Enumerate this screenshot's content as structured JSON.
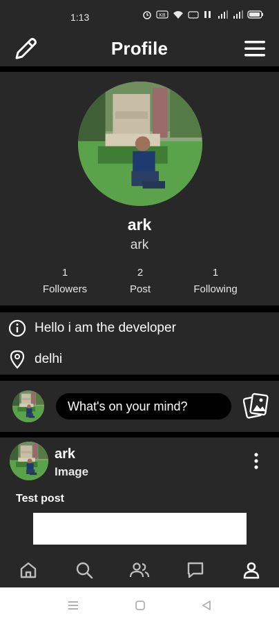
{
  "status_bar": {
    "time": "1:13",
    "icons": [
      "alarm-icon",
      "speed-icon",
      "wifi-icon",
      "volte-icon",
      "data-icon",
      "signal-icon",
      "signal-icon",
      "battery-icon"
    ]
  },
  "header": {
    "title": "Profile",
    "left_icon": "edit-icon",
    "right_icon": "menu-icon"
  },
  "profile": {
    "name": "ark",
    "username": "ark",
    "stats": [
      {
        "value": "1",
        "label": "Followers"
      },
      {
        "value": "2",
        "label": "Post"
      },
      {
        "value": "1",
        "label": "Following"
      }
    ]
  },
  "info": {
    "bio": "Hello i am the developer",
    "location": "delhi"
  },
  "composer": {
    "placeholder": "What's on your mind?",
    "icon": "gallery-icon"
  },
  "post": {
    "author": "ark",
    "type": "Image",
    "caption": "Test post"
  },
  "bottom_nav": {
    "items": [
      "home-icon",
      "search-icon",
      "people-icon",
      "chat-icon",
      "profile-icon"
    ],
    "active": "profile-icon"
  },
  "colors": {
    "background": "#000000",
    "card": "#282828",
    "text": "#ffffff",
    "system_nav": "#ffffff"
  }
}
